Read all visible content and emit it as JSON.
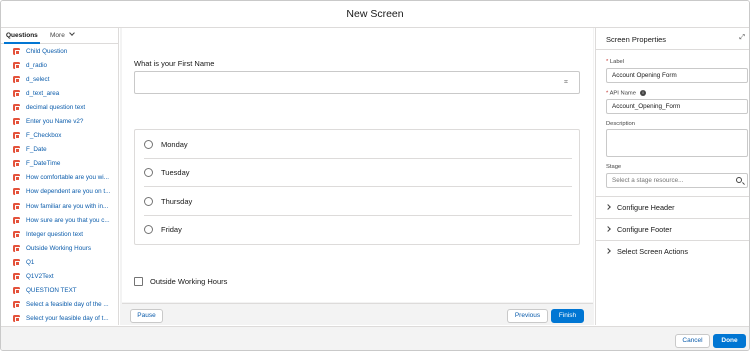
{
  "window": {
    "title": "New Screen"
  },
  "left_panel": {
    "tabs": {
      "questions": "Questions",
      "more": "More"
    },
    "items": [
      "Child Question",
      "d_radio",
      "d_select",
      "d_text_area",
      "decimal question text",
      "Enter you Name v2?",
      "F_Checkbox",
      "F_Date",
      "F_DateTime",
      "How comfortable are you wi...",
      "How dependent are you on t...",
      "How familiar are you with in...",
      "How sure are you that you c...",
      "Integer question text",
      "Outside Working Hours",
      "Q1",
      "Q1V2Text",
      "QUESTION TEXT",
      "Select a feasible day of the ...",
      "Select your feasible day of t..."
    ]
  },
  "canvas": {
    "text_question": {
      "label": "What is your First Name",
      "value": ""
    },
    "radio_options": [
      "Monday",
      "Tuesday",
      "Thursday",
      "Friday"
    ],
    "checkbox": {
      "label": "Outside Working Hours"
    },
    "footer": {
      "pause": "Pause",
      "previous": "Previous",
      "finish": "Finish"
    }
  },
  "properties": {
    "title": "Screen Properties",
    "label_field": {
      "label": "Label",
      "value": "Account Opening Form"
    },
    "api_name_field": {
      "label": "API Name",
      "value": "Account_Opening_Form"
    },
    "description_field": {
      "label": "Description"
    },
    "stage_field": {
      "label": "Stage",
      "placeholder": "Select a stage resource..."
    },
    "sections": [
      "Configure Header",
      "Configure Footer",
      "Select Screen Actions"
    ]
  },
  "footer": {
    "cancel": "Cancel",
    "done": "Done"
  },
  "colors": {
    "brand": "#0176d3",
    "link": "#0b5cab",
    "question_icon": "#e4523b"
  }
}
